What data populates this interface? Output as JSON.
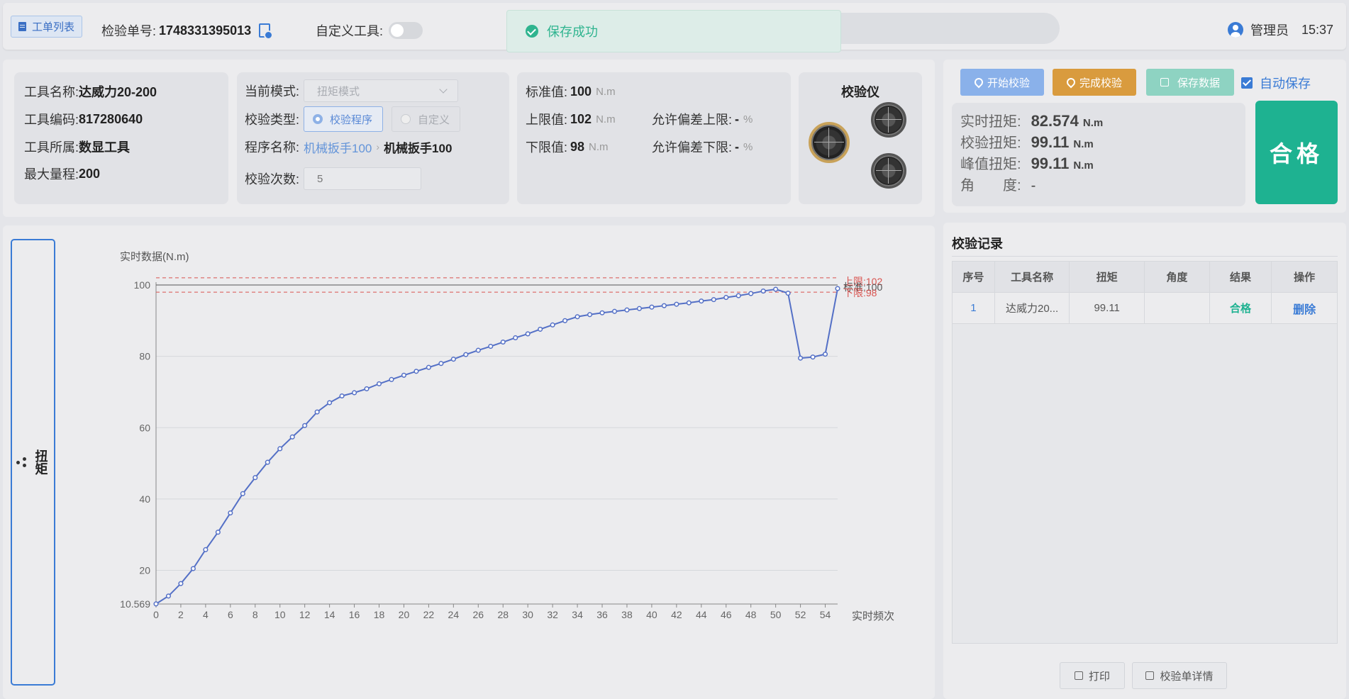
{
  "topbar": {
    "orders_btn": "工单列表",
    "order_no_label": "检验单号:",
    "order_no": "1748331395013",
    "custom_tool_label": "自定义工具:",
    "toast": "保存成功",
    "user": "管理员",
    "time": "15:37"
  },
  "tool": {
    "name_label": "工具名称:",
    "name": "达威力20-200",
    "code_label": "工具编码:",
    "code": "817280640",
    "type_label": "工具所属:",
    "type": "数显工具",
    "range_label": "最大量程:",
    "range": "200"
  },
  "mode": {
    "mode_label": "当前模式:",
    "mode_value": "扭矩模式",
    "cal_type_label": "校验类型:",
    "cal_type_options": [
      "校验程序",
      "自定义"
    ],
    "program_label": "程序名称:",
    "program_path": [
      "机械扳手100",
      "机械扳手100"
    ],
    "count_label": "校验次数:",
    "count": "5"
  },
  "limits": {
    "std_label": "标准值:",
    "std": "100",
    "unit": "N.m",
    "upper_label": "上限值:",
    "upper": "102",
    "lower_label": "下限值:",
    "lower": "98",
    "tol_up_label": "允许偏差上限:",
    "tol_up": "-",
    "tol_down_label": "允许偏差下限:",
    "tol_down": "-",
    "pct": "%"
  },
  "device": {
    "title": "校验仪"
  },
  "actions": {
    "start": "开始校验",
    "finish": "完成校验",
    "save": "保存数据",
    "autosave": "自动保存"
  },
  "metrics": {
    "realtime_label": "实时扭矩:",
    "realtime": "82.574",
    "cal_label": "校验扭矩:",
    "cal": "99.11",
    "peak_label": "峰值扭矩:",
    "peak": "99.11",
    "angle_label": "角　　度:",
    "angle": "-",
    "unit": "N.m",
    "result": "合格"
  },
  "chart_tab": "扭矩",
  "chart_data": {
    "type": "line",
    "ylabel": "实时数据(N.m)",
    "xlabel": "实时频次",
    "ylim": [
      10.569,
      100
    ],
    "y_ticks": [
      "10.569",
      "20",
      "40",
      "60",
      "80",
      "100"
    ],
    "x_ticks": [
      "0",
      "2",
      "4",
      "6",
      "8",
      "10",
      "12",
      "14",
      "16",
      "18",
      "20",
      "22",
      "24",
      "26",
      "28",
      "30",
      "32",
      "34",
      "36",
      "38",
      "40",
      "42",
      "44",
      "46",
      "48",
      "50",
      "52",
      "54"
    ],
    "x": [
      0,
      1,
      2,
      3,
      4,
      5,
      6,
      7,
      8,
      9,
      10,
      11,
      12,
      13,
      14,
      15,
      16,
      17,
      18,
      19,
      20,
      21,
      22,
      23,
      24,
      25,
      26,
      27,
      28,
      29,
      30,
      31,
      32,
      33,
      34,
      35,
      36,
      37,
      38,
      39,
      40,
      41,
      42,
      43,
      44,
      45,
      46,
      47,
      48,
      49,
      50,
      51,
      52,
      53,
      54,
      55
    ],
    "values": [
      10.6,
      12.8,
      16.3,
      20.5,
      25.8,
      30.7,
      36.1,
      41.5,
      46.0,
      50.3,
      54.1,
      57.4,
      60.6,
      64.4,
      67.0,
      68.9,
      69.8,
      70.9,
      72.3,
      73.5,
      74.7,
      75.8,
      76.9,
      78.0,
      79.2,
      80.5,
      81.7,
      82.8,
      84.0,
      85.2,
      86.3,
      87.6,
      88.8,
      90.0,
      91.1,
      91.7,
      92.2,
      92.6,
      93.0,
      93.4,
      93.8,
      94.2,
      94.6,
      95.0,
      95.5,
      95.9,
      96.5,
      97.0,
      97.6,
      98.3,
      98.8,
      97.7,
      79.5,
      79.8,
      80.6,
      99.0
    ],
    "ref_lines": [
      {
        "label": "上限:102",
        "value": 102,
        "color": "#d9534f"
      },
      {
        "label": "标准:100",
        "value": 100,
        "color": "#555555"
      },
      {
        "label": "下限:98",
        "value": 98,
        "color": "#d9534f"
      }
    ],
    "series_color": "#5470c6"
  },
  "records": {
    "title": "校验记录",
    "headers": [
      "序号",
      "工具名称",
      "扭矩",
      "角度",
      "结果",
      "操作"
    ],
    "rows": [
      {
        "no": "1",
        "name": "达威力20...",
        "torque": "99.11",
        "angle": "",
        "result": "合格",
        "op": "删除"
      }
    ],
    "print": "打印",
    "detail": "校验单详情"
  }
}
